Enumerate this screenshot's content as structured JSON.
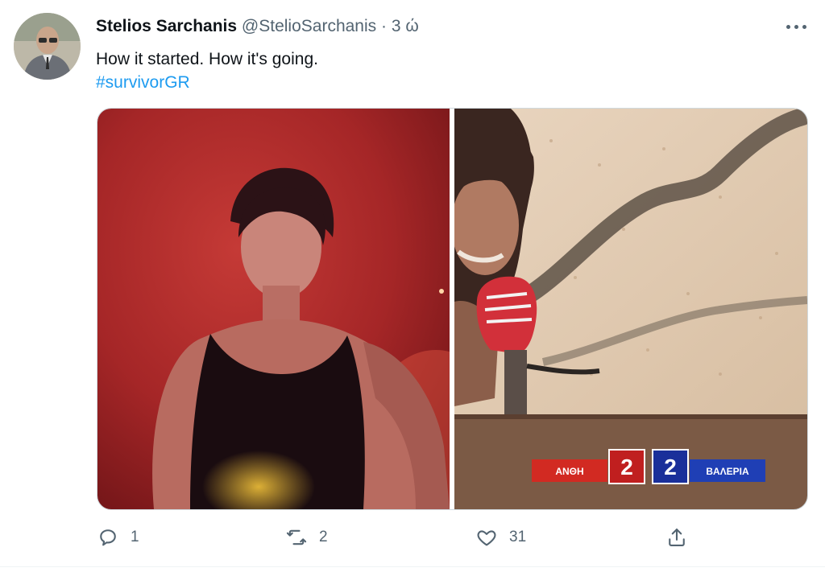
{
  "tweet": {
    "author_name": "Stelios Sarchanis",
    "author_handle": "@StelioSarchanis",
    "separator": "·",
    "timestamp": "3 ώ",
    "text": "How it started. How it's going.",
    "hashtag": "#survivorGR"
  },
  "scoreboard": {
    "left_team": "ΑΝΘΗ",
    "left_score": "2",
    "right_score": "2",
    "right_team": "ΒΑΛΕΡΙΑ",
    "left_color": "#d22a22",
    "right_color": "#1f3fb5"
  },
  "actions": {
    "reply_count": "1",
    "retweet_count": "2",
    "like_count": "31"
  },
  "icons": [
    "more-icon",
    "reply-icon",
    "retweet-icon",
    "like-icon",
    "share-icon"
  ],
  "colors": {
    "text_primary": "#0f1419",
    "text_secondary": "#536471",
    "accent": "#1d9bf0"
  }
}
